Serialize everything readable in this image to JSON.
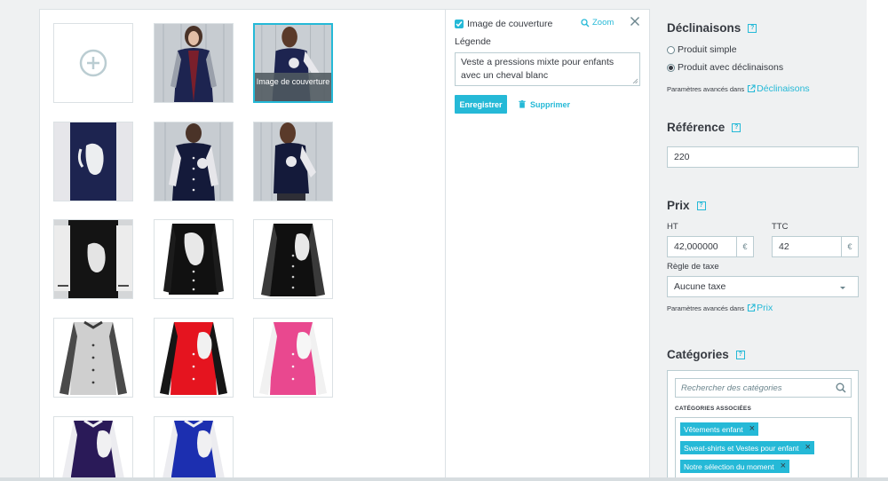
{
  "images": {
    "selected_overlay": "Image de couverture"
  },
  "detail": {
    "cover_checkbox_label": "Image de couverture",
    "cover_checked": true,
    "zoom_label": "Zoom",
    "legend_label": "Légende",
    "legend_value": "Veste a pressions mixte pour enfants avec un cheval blanc",
    "save_label": "Enregistrer",
    "delete_label": "Supprimer"
  },
  "sidebar": {
    "declinaisons": {
      "title": "Déclinaisons",
      "help": "?",
      "option_simple": "Produit simple",
      "option_variants": "Produit avec déclinaisons",
      "selected": "option_variants",
      "advanced_prefix": "Paramètres avancés dans",
      "advanced_link": "Déclinaisons"
    },
    "reference": {
      "title": "Référence",
      "help": "?",
      "value": "220"
    },
    "prix": {
      "title": "Prix",
      "help": "?",
      "ht_label": "HT",
      "ttc_label": "TTC",
      "ht_value": "42,000000",
      "ttc_value": "42",
      "currency": "€",
      "tax_label": "Règle de taxe",
      "tax_value": "Aucune taxe",
      "advanced_prefix": "Paramètres avancés dans",
      "advanced_link": "Prix"
    },
    "categories": {
      "title": "Catégories",
      "help": "?",
      "search_placeholder": "Rechercher des catégories",
      "assoc_label": "CATÉGORIES ASSOCIÉES",
      "tags": [
        "Vêtements enfant",
        "Sweat-shirts et Vestes pour enfant",
        "Notre sélection du moment"
      ]
    }
  },
  "colors": {
    "accent": "#25b9d7",
    "text": "#363a41",
    "border": "#bbcdd2",
    "background": "#eff1f2"
  }
}
